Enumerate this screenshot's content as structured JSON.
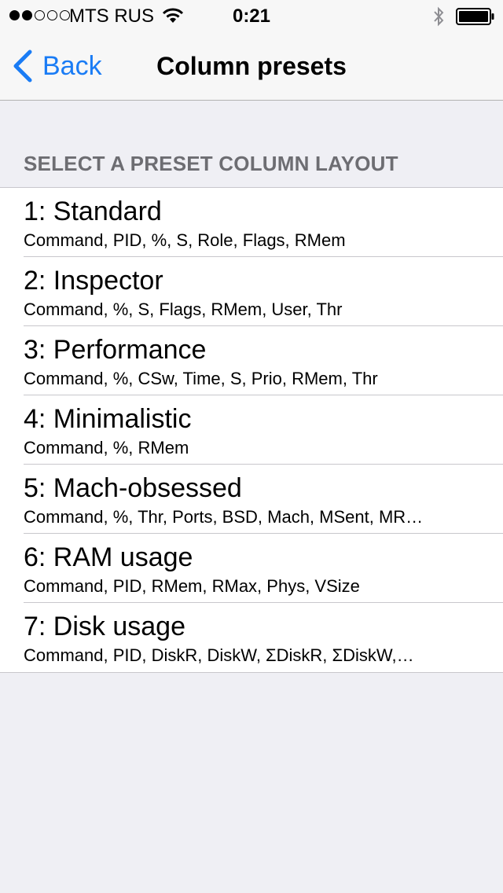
{
  "status_bar": {
    "carrier": "MTS RUS",
    "time": "0:21",
    "signal_bars_filled": 2,
    "signal_bars_total": 5
  },
  "nav": {
    "back_label": "Back",
    "title": "Column presets"
  },
  "section": {
    "header": "SELECT A PRESET COLUMN LAYOUT"
  },
  "presets": [
    {
      "title": "1: Standard",
      "columns": "Command, PID, %, S, Role, Flags, RMem"
    },
    {
      "title": "2: Inspector",
      "columns": "Command, %, S, Flags, RMem, User, Thr"
    },
    {
      "title": "3: Performance",
      "columns": "Command, %, CSw, Time, S, Prio, RMem, Thr"
    },
    {
      "title": "4: Minimalistic",
      "columns": "Command, %, RMem"
    },
    {
      "title": "5: Mach-obsessed",
      "columns": "Command, %, Thr, Ports, BSD, Mach, MSent, MR…"
    },
    {
      "title": "6: RAM usage",
      "columns": "Command, PID, RMem, RMax, Phys, VSize"
    },
    {
      "title": "7: Disk usage",
      "columns": "Command, PID, DiskR, DiskW, ΣDiskR, ΣDiskW,…"
    }
  ],
  "colors": {
    "accent": "#1a7cf5",
    "background": "#efeff4",
    "section_header": "#6d6d72"
  },
  "icons": {
    "back": "chevron-left-icon",
    "wifi": "wifi-icon",
    "bluetooth": "bluetooth-icon",
    "battery": "battery-icon"
  }
}
